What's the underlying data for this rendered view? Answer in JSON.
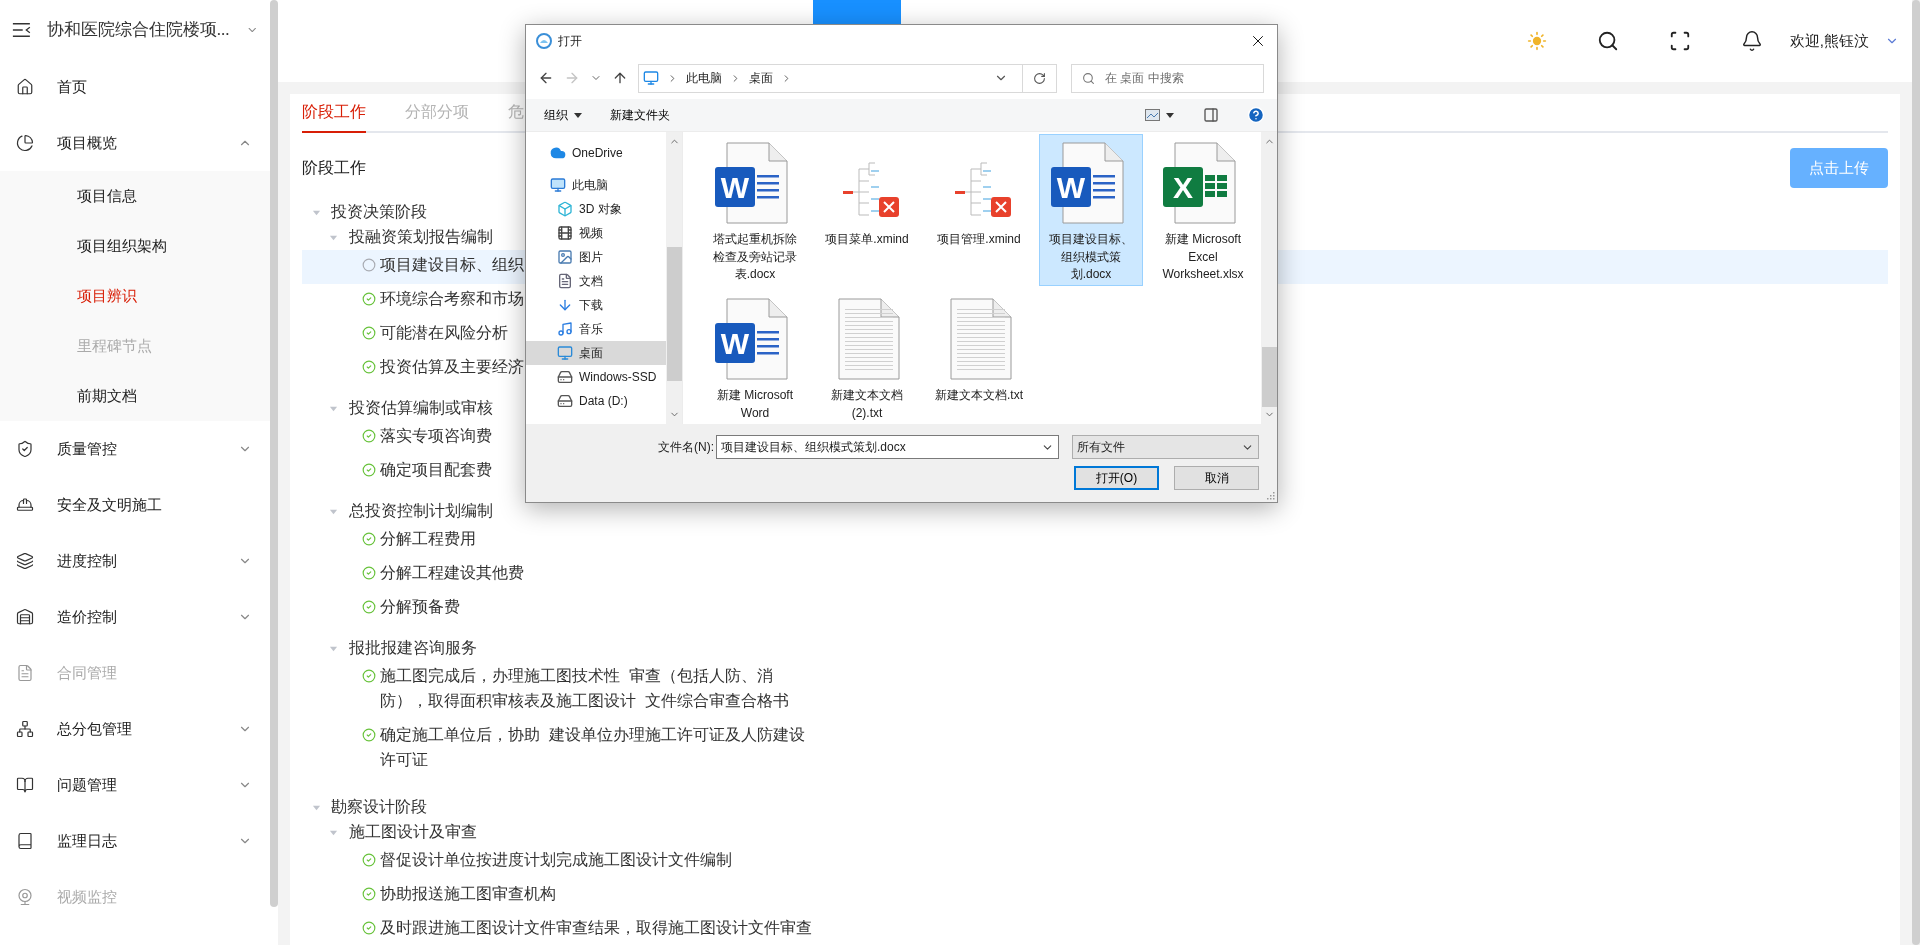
{
  "sidebar": {
    "title": "协和医院综合住院楼项...",
    "items": [
      {
        "kind": "link",
        "label": "首页",
        "selected": false,
        "disabled": false
      },
      {
        "kind": "group",
        "label": "项目概览",
        "selected": false,
        "disabled": false,
        "expanded": true,
        "children": [
          {
            "label": "项目信息",
            "selected": false,
            "disabled": false
          },
          {
            "label": "项目组织架构",
            "selected": false,
            "disabled": false
          },
          {
            "label": "项目辨识",
            "selected": true,
            "disabled": false
          },
          {
            "label": "里程碑节点",
            "selected": false,
            "disabled": true
          },
          {
            "label": "前期文档",
            "selected": false,
            "disabled": false
          }
        ]
      },
      {
        "kind": "group",
        "label": "质量管控",
        "selected": false,
        "disabled": false,
        "expanded": false
      },
      {
        "kind": "link",
        "label": "安全及文明施工",
        "selected": false,
        "disabled": false
      },
      {
        "kind": "group",
        "label": "进度控制",
        "selected": false,
        "disabled": false,
        "expanded": false
      },
      {
        "kind": "group",
        "label": "造价控制",
        "selected": false,
        "disabled": false,
        "expanded": false
      },
      {
        "kind": "link",
        "label": "合同管理",
        "selected": false,
        "disabled": true
      },
      {
        "kind": "group",
        "label": "总分包管理",
        "selected": false,
        "disabled": false,
        "expanded": false
      },
      {
        "kind": "group",
        "label": "问题管理",
        "selected": false,
        "disabled": false,
        "expanded": false
      },
      {
        "kind": "group",
        "label": "监理日志",
        "selected": false,
        "disabled": false,
        "expanded": false
      },
      {
        "kind": "link",
        "label": "视频监控",
        "selected": false,
        "disabled": true
      }
    ]
  },
  "header": {
    "user": "欢迎,熊钰汶"
  },
  "tabs": [
    {
      "label": "阶段工作",
      "selected": true
    },
    {
      "label": "分部分项",
      "selected": false
    },
    {
      "label": "危",
      "selected": false
    }
  ],
  "section_title": "阶段工作",
  "upload_button": "点击上传",
  "tree": [
    {
      "label": "投资决策阶段",
      "expanded": true,
      "children": [
        {
          "label": "投融资策划报告编制",
          "expanded": true,
          "children": [
            {
              "label": "项目建设目标、组织",
              "done": false,
              "selected": true
            },
            {
              "label": "环境综合考察和市场",
              "done": true,
              "selected": false
            },
            {
              "label": "可能潜在风险分析",
              "done": true,
              "selected": false
            },
            {
              "label": "投资估算及主要经济",
              "done": true,
              "selected": false
            }
          ]
        },
        {
          "label": "投资估算编制或审核",
          "expanded": true,
          "children": [
            {
              "label": "落实专项咨询费",
              "done": true,
              "selected": false
            },
            {
              "label": "确定项目配套费",
              "done": true,
              "selected": false
            }
          ]
        },
        {
          "label": "总投资控制计划编制",
          "expanded": true,
          "children": [
            {
              "label": "分解工程费用",
              "done": true,
              "selected": false
            },
            {
              "label": "分解工程建设其他费",
              "done": true,
              "selected": false
            },
            {
              "label": "分解预备费",
              "done": true,
              "selected": false
            }
          ]
        },
        {
          "label": "报批报建咨询服务",
          "expanded": true,
          "children": [
            {
              "label": "施工图完成后，办理施工图技术性  审查（包括人防、消防），取得面积审核表及施工图设计  文件综合审查合格书",
              "done": true,
              "selected": false
            },
            {
              "label": "确定施工单位后，协助  建设单位办理施工许可证及人防建设许可证",
              "done": true,
              "selected": false
            }
          ]
        }
      ]
    },
    {
      "label": "勘察设计阶段",
      "expanded": true,
      "children": [
        {
          "label": "施工图设计及审查",
          "expanded": true,
          "children": [
            {
              "label": "督促设计单位按进度计划完成施工图设计文件编制",
              "done": true,
              "selected": false
            },
            {
              "label": "协助报送施工图审查机构",
              "done": true,
              "selected": false
            },
            {
              "label": "及时跟进施工图设计文件审查结果，取得施工图设计文件审查",
              "done": true,
              "selected": false
            }
          ]
        }
      ]
    }
  ],
  "dialog": {
    "title": "打开",
    "path": [
      "此电脑",
      "桌面"
    ],
    "search_placeholder": "在 桌面 中搜索",
    "toolbar": [
      {
        "label": "组织",
        "kind": "menu"
      },
      {
        "label": "新建文件夹",
        "kind": "button"
      }
    ],
    "nav": [
      {
        "label": "OneDrive",
        "selected": false
      },
      {
        "label": "此电脑",
        "selected": false,
        "children": [
          {
            "label": "3D 对象",
            "selected": false
          },
          {
            "label": "视频",
            "selected": false
          },
          {
            "label": "图片",
            "selected": false
          },
          {
            "label": "文档",
            "selected": false
          },
          {
            "label": "下载",
            "selected": false
          },
          {
            "label": "音乐",
            "selected": false
          },
          {
            "label": "桌面",
            "selected": true
          },
          {
            "label": "Windows-SSD",
            "selected": false
          },
          {
            "label": "Data (D:)",
            "selected": false
          }
        ]
      }
    ],
    "files": [
      {
        "kind": "word",
        "badge": "W",
        "name": "塔式起重机拆除检查及旁站记录表.docx",
        "selected": false
      },
      {
        "kind": "xmind",
        "name": "项目菜单.xmind",
        "selected": false
      },
      {
        "kind": "xmind",
        "name": "项目管理.xmind",
        "selected": false
      },
      {
        "kind": "word",
        "badge": "W",
        "name": "项目建设目标、组织模式策划.docx",
        "selected": true
      },
      {
        "kind": "excel",
        "badge": "X",
        "name": "新建 Microsoft Excel Worksheet.xlsx",
        "selected": false
      },
      {
        "kind": "word",
        "badge": "W",
        "name": "新建 Microsoft Word",
        "selected": false
      },
      {
        "kind": "text",
        "name": "新建文本文档 (2).txt",
        "selected": false
      },
      {
        "kind": "text",
        "name": "新建文本文档.txt",
        "selected": false
      }
    ],
    "filename_label": "文件名(N):",
    "filename": "项目建设目标、组织模式策划.docx",
    "filetype": "所有文件",
    "buttons": [
      {
        "label": "打开(O)",
        "default": true
      },
      {
        "label": "取消",
        "default": false
      }
    ]
  }
}
